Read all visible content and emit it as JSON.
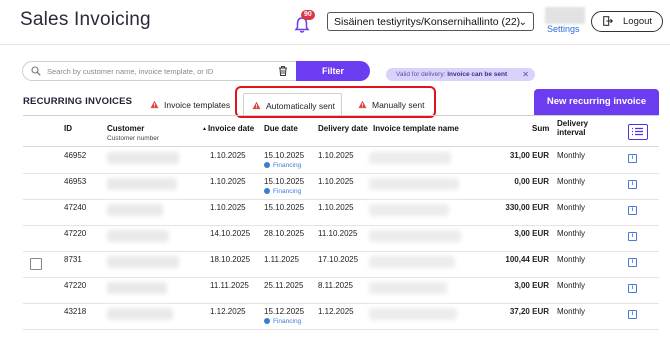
{
  "header": {
    "title": "Sales Invoicing",
    "notification_count": "90",
    "company": "Sisäinen testiyritys/Konsernihallinto (22)",
    "settings_label": "Settings",
    "logout_label": "Logout"
  },
  "search": {
    "placeholder": "Search by customer name, invoice template, or ID",
    "filter_label": "Filter"
  },
  "chip": {
    "prefix": "Valid for delivery: ",
    "value": "Invoice can be sent"
  },
  "section": {
    "title": "RECURRING INVOICES",
    "tabs": [
      "Invoice templates",
      "Automatically sent",
      "Manually sent"
    ],
    "active_tab": "Automatically sent",
    "new_button": "New recurring invoice"
  },
  "table": {
    "columns": {
      "id": "ID",
      "customer": "Customer",
      "customer_sub": "Customer number",
      "invoice_date": "Invoice date",
      "due_date": "Due date",
      "delivery_date": "Delivery date",
      "template": "Invoice template name",
      "sum": "Sum",
      "interval_line1": "Delivery",
      "interval_line2": "interval"
    },
    "sort_indicator": "▲",
    "financing_label": "Financing",
    "rows": [
      {
        "id": "46952",
        "invoice_date": "1.10.2025",
        "due_date": "15.10.2025",
        "financing": true,
        "delivery_date": "1.10.2025",
        "sum": "31,00 EUR",
        "interval": "Monthly"
      },
      {
        "id": "46953",
        "invoice_date": "1.10.2025",
        "due_date": "15.10.2025",
        "financing": true,
        "delivery_date": "1.10.2025",
        "sum": "0,00 EUR",
        "interval": "Monthly"
      },
      {
        "id": "47240",
        "invoice_date": "1.10.2025",
        "due_date": "15.10.2025",
        "financing": false,
        "delivery_date": "1.10.2025",
        "sum": "330,00 EUR",
        "interval": "Monthly"
      },
      {
        "id": "47220",
        "invoice_date": "14.10.2025",
        "due_date": "28.10.2025",
        "financing": false,
        "delivery_date": "11.10.2025",
        "sum": "3,00 EUR",
        "interval": "Monthly"
      },
      {
        "id": "8731",
        "invoice_date": "18.10.2025",
        "due_date": "1.11.2025",
        "financing": false,
        "delivery_date": "17.10.2025",
        "sum": "100,44 EUR",
        "interval": "Monthly",
        "checkbox": true
      },
      {
        "id": "47220",
        "invoice_date": "11.11.2025",
        "due_date": "25.11.2025",
        "financing": false,
        "delivery_date": "8.11.2025",
        "sum": "3,00 EUR",
        "interval": "Monthly"
      },
      {
        "id": "43218",
        "invoice_date": "1.12.2025",
        "due_date": "15.12.2025",
        "financing": true,
        "delivery_date": "1.12.2025",
        "sum": "37,20 EUR",
        "interval": "Monthly"
      }
    ]
  }
}
